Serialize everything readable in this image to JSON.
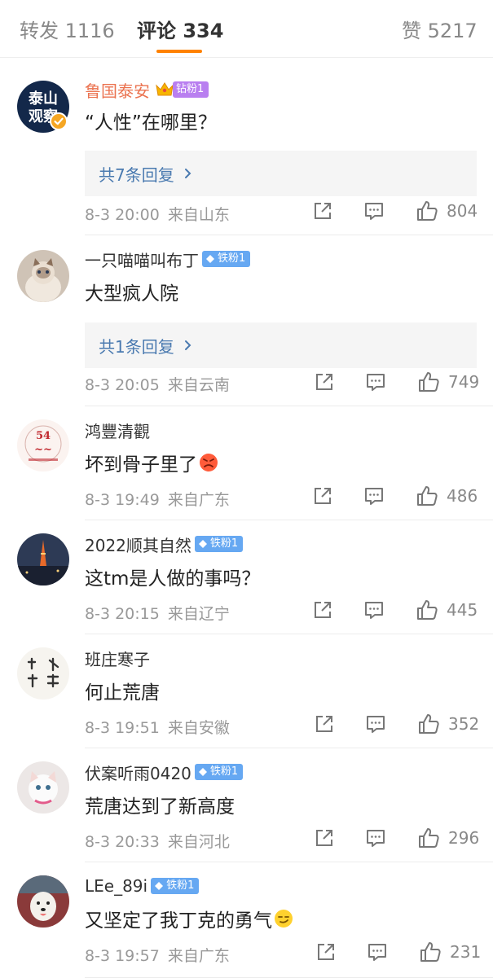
{
  "tabs": [
    {
      "label": "转发 1116"
    },
    {
      "label": "评论 334"
    },
    {
      "label": "赞 5217"
    }
  ],
  "colors": {
    "accent": "#ff8200",
    "vip_name": "#eb7350",
    "reply_link": "#4a7ab0",
    "iron_badge": "#66a8f2",
    "diamond_badge": "#b97ff0"
  },
  "comments": [
    {
      "avatar": "avatar-taishan-guancha",
      "avatar_text": [
        "泰山",
        "观察"
      ],
      "user": "鲁国泰安",
      "badge": "钻粉1",
      "badge_type": "diamond",
      "crown": true,
      "verified": true,
      "text": "“人性”在哪里？",
      "replies": "共7条回复",
      "time": "8-3 20:00",
      "location": "来自山东",
      "likes": "804"
    },
    {
      "avatar": "avatar-cat-photo",
      "user": "一只喵喵叫布丁",
      "badge": "铁粉1",
      "badge_type": "iron",
      "text": "大型疯人院",
      "replies": "共1条回复",
      "time": "8-3 20:05",
      "location": "来自云南",
      "likes": "749"
    },
    {
      "avatar": "avatar-youth-day",
      "user": "鸿豐清觀",
      "badge": "",
      "text": "坏到骨子里了",
      "emoji": "angry-face-emoji",
      "time": "8-3 19:49",
      "location": "来自广东",
      "likes": "486"
    },
    {
      "avatar": "avatar-tower-night",
      "user": "2022顺其自然",
      "badge": "铁粉1",
      "badge_type": "iron",
      "text": "这tm是人做的事吗？",
      "time": "8-3 20:15",
      "location": "来自辽宁",
      "likes": "445"
    },
    {
      "avatar": "avatar-calligraphy",
      "user": "班庄寒子",
      "badge": "",
      "text": "何止荒唐",
      "time": "8-3 19:51",
      "location": "来自安徽",
      "likes": "352"
    },
    {
      "avatar": "avatar-kitten",
      "user": "伏案听雨0420",
      "badge": "铁粉1",
      "badge_type": "iron",
      "text": "荒唐达到了新高度",
      "time": "8-3 20:33",
      "location": "来自河北",
      "likes": "296"
    },
    {
      "avatar": "avatar-dog",
      "user": "LEe_89i",
      "badge": "铁粉1",
      "badge_type": "iron",
      "text": "又坚定了我丁克的勇气",
      "emoji": "smirk-face-emoji",
      "time": "8-3 19:57",
      "location": "来自广东",
      "likes": "231"
    }
  ]
}
